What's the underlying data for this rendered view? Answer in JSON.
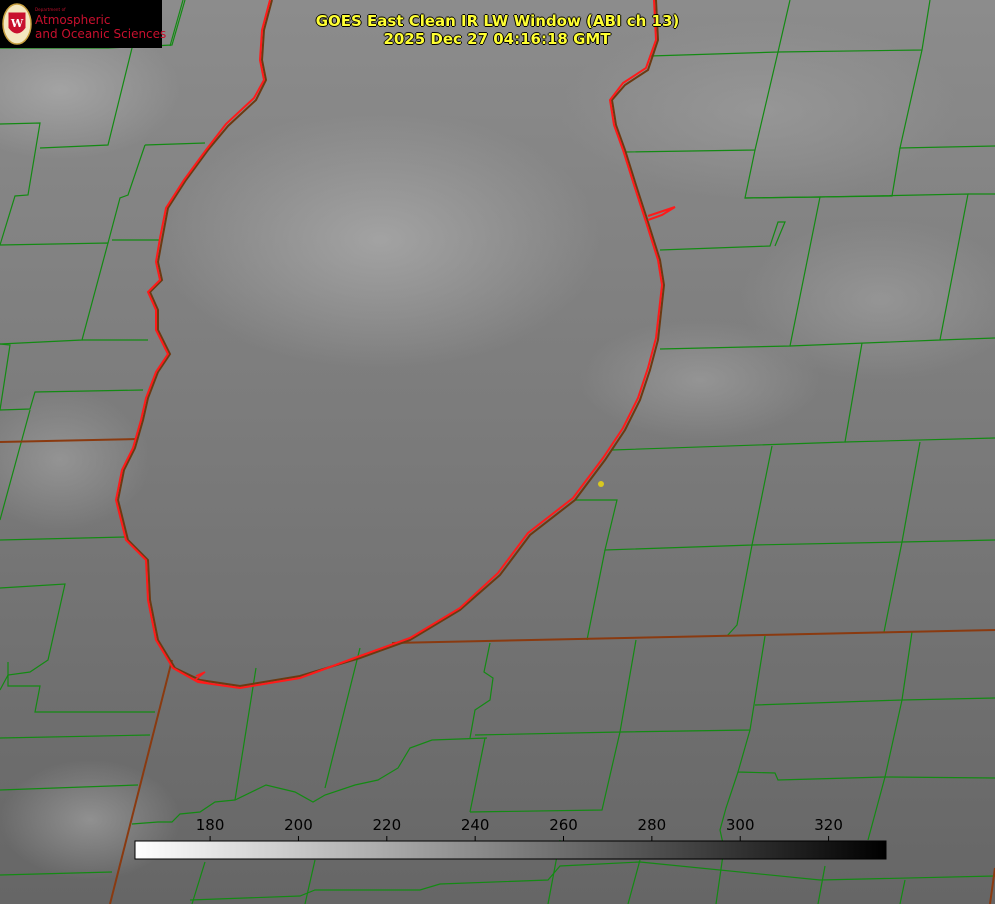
{
  "header": {
    "title_line1": "GOES East Clean IR LW Window (ABI ch 13)",
    "title_line2": "2025 Dec 27 04:16:18 GMT"
  },
  "logo": {
    "seal_letter": "W",
    "dept_text": "Department of",
    "line1": "Atmospheric",
    "line2": "and Oceanic Sciences"
  },
  "colorbar": {
    "ticks": [
      "180",
      "200",
      "220",
      "240",
      "260",
      "280",
      "300",
      "320"
    ],
    "range": [
      163,
      333
    ],
    "gradient": "white-to-black"
  },
  "colors": {
    "county_lines": "#138a13",
    "shoreline": "#ff1a1a",
    "state_lines": "#8a3a10",
    "title_text": "#ffff33",
    "background": "#6e6e6e"
  },
  "markers": [
    {
      "name": "city-marker",
      "color": "#d8c820"
    }
  ]
}
